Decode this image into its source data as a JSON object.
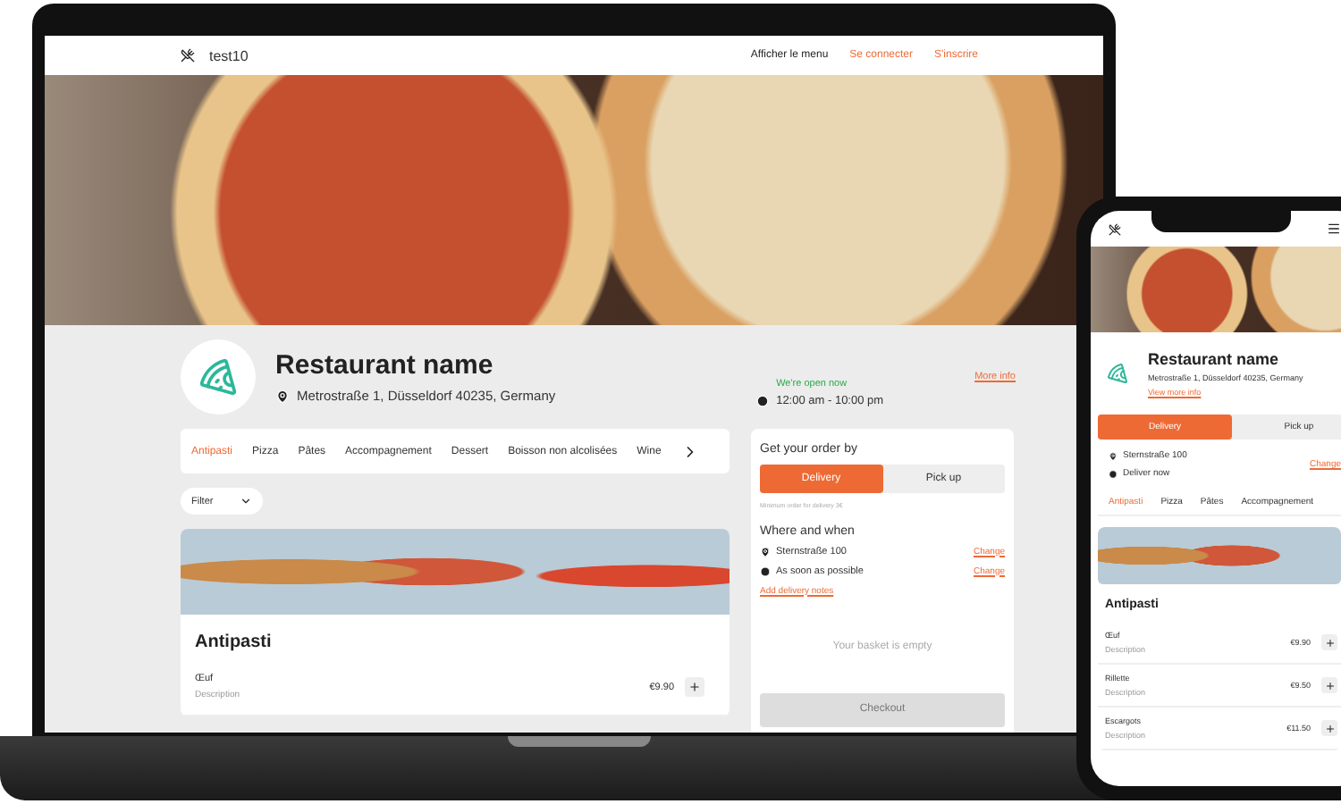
{
  "laptop": {
    "nav": {
      "brand": "test10",
      "links": [
        {
          "label": "Afficher le menu",
          "kind": "plain"
        },
        {
          "label": "Se connecter",
          "kind": "accent"
        },
        {
          "label": "S'inscrire",
          "kind": "accent"
        }
      ]
    },
    "restaurant": {
      "name": "Restaurant name",
      "address": "Metrostraße 1, Düsseldorf 40235, Germany",
      "open_status": "We're open now",
      "hours": "12:00 am - 10:00 pm",
      "more_info": "More info"
    },
    "categories": [
      {
        "label": "Antipasti",
        "selected": true
      },
      {
        "label": "Pizza",
        "selected": false
      },
      {
        "label": "Pâtes",
        "selected": false
      },
      {
        "label": "Accompagnement",
        "selected": false
      },
      {
        "label": "Dessert",
        "selected": false
      },
      {
        "label": "Boisson non alcolisées",
        "selected": false
      },
      {
        "label": "Wine",
        "selected": false
      }
    ],
    "filter": "Filter",
    "section": {
      "title": "Antipasti",
      "items": [
        {
          "name": "Œuf",
          "description": "Description",
          "price": "€9.90"
        }
      ]
    },
    "order": {
      "title": "Get your order by",
      "modes": [
        {
          "label": "Delivery",
          "selected": true
        },
        {
          "label": "Pick up",
          "selected": false
        }
      ],
      "minimum_note": "Minimum order for delivery 3€",
      "where_title": "Where and when",
      "details": [
        {
          "kind": "location",
          "text": "Sternstraße 100",
          "action": "Change"
        },
        {
          "kind": "time",
          "text": "As soon as possible",
          "action": "Change"
        }
      ],
      "notes_link": "Add delivery notes",
      "basket": "Your basket is empty",
      "checkout": "Checkout"
    }
  },
  "phone": {
    "restaurant": {
      "name": "Restaurant name",
      "address": "Metrostraße 1, Düsseldorf 40235, Germany",
      "more_info": "View more info"
    },
    "modes": [
      {
        "label": "Delivery",
        "selected": true
      },
      {
        "label": "Pick up",
        "selected": false
      }
    ],
    "details": [
      {
        "kind": "location",
        "text": "Sternstraße 100"
      },
      {
        "kind": "time",
        "text": "Deliver now"
      }
    ],
    "change": "Change",
    "categories": [
      {
        "label": "Antipasti",
        "selected": true
      },
      {
        "label": "Pizza",
        "selected": false
      },
      {
        "label": "Pâtes",
        "selected": false
      },
      {
        "label": "Accompagnement",
        "selected": false
      }
    ],
    "section": {
      "title": "Antipasti",
      "items": [
        {
          "name": "Œuf",
          "description": "Description",
          "price": "€9.90"
        },
        {
          "name": "Rillette",
          "description": "Description",
          "price": "€9.50"
        },
        {
          "name": "Escargots",
          "description": "Description",
          "price": "€11.50"
        }
      ]
    }
  }
}
